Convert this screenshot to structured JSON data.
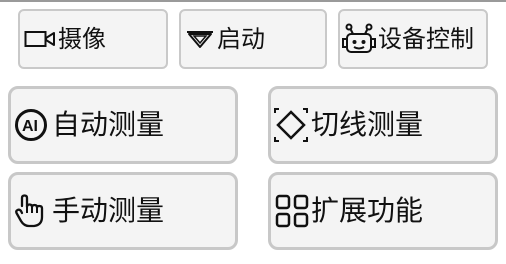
{
  "top_buttons": [
    {
      "label": "摄像",
      "icon": "camera-icon"
    },
    {
      "label": "启动",
      "icon": "play-icon"
    },
    {
      "label": "设备控制",
      "icon": "robot-icon"
    }
  ],
  "measure_buttons": [
    {
      "label": "自动测量",
      "icon": "ai-icon"
    },
    {
      "label": "切线测量",
      "icon": "tangent-icon"
    },
    {
      "label": "手动测量",
      "icon": "hand-icon"
    },
    {
      "label": "扩展功能",
      "icon": "grid-icon"
    }
  ]
}
